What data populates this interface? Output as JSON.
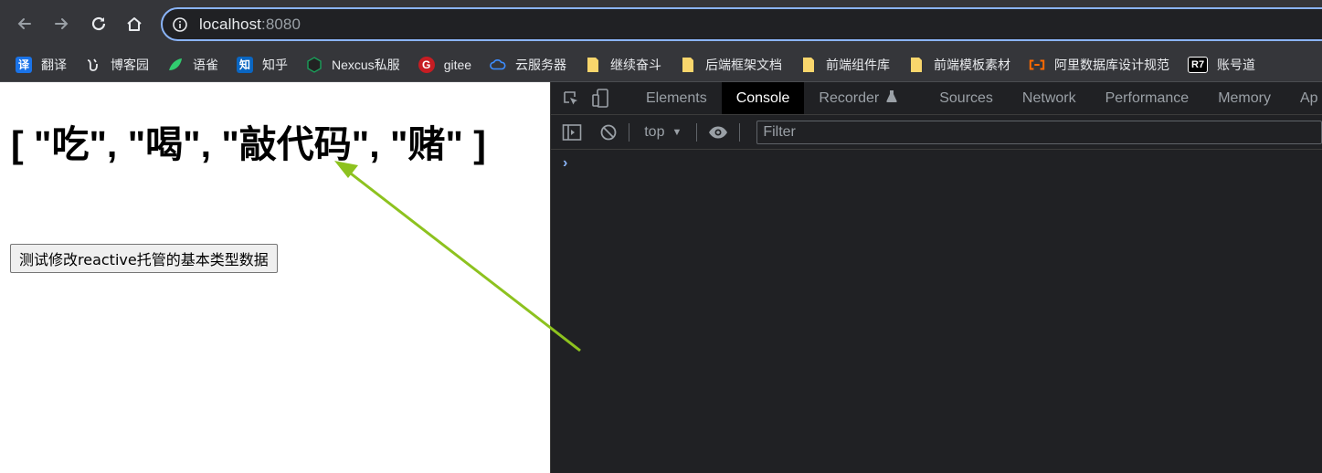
{
  "browser": {
    "url_host": "localhost",
    "url_port": ":8080"
  },
  "bookmarks": [
    {
      "label": "翻译",
      "icon": "translate-icon",
      "icon_text": "译",
      "color": "#1a73e8"
    },
    {
      "label": "博客园",
      "icon": "cnblogs-icon",
      "icon_text": "",
      "color": ""
    },
    {
      "label": "语雀",
      "icon": "yuque-icon",
      "icon_text": "",
      "color": "#31cc6f"
    },
    {
      "label": "知乎",
      "icon": "zhihu-icon",
      "icon_text": "知",
      "color": "#0a66c2"
    },
    {
      "label": "Nexcus私服",
      "icon": "nexus-icon",
      "icon_text": "",
      "color": "#1b9e5a"
    },
    {
      "label": "gitee",
      "icon": "gitee-icon",
      "icon_text": "G",
      "color": "#c71d23"
    },
    {
      "label": "云服务器",
      "icon": "cloud-icon",
      "icon_text": "",
      "color": "#3c8cff"
    },
    {
      "label": "继续奋斗",
      "icon": "folder-icon",
      "icon_text": "",
      "color": "#f9d66c"
    },
    {
      "label": "后端框架文档",
      "icon": "folder-icon",
      "icon_text": "",
      "color": "#f9d66c"
    },
    {
      "label": "前端组件库",
      "icon": "folder-icon",
      "icon_text": "",
      "color": "#f9d66c"
    },
    {
      "label": "前端模板素材",
      "icon": "folder-icon",
      "icon_text": "",
      "color": "#f9d66c"
    },
    {
      "label": "阿里数据库设计规范",
      "icon": "aliyun-icon",
      "icon_text": "",
      "color": "#ff6a00"
    },
    {
      "label": "账号道",
      "icon": "r7-icon",
      "icon_text": "R7",
      "color": "#000000"
    }
  ],
  "page": {
    "heading": "[ \"吃\", \"喝\", \"敲代码\", \"赌\" ]",
    "button_label": "测试修改reactive托管的基本类型数据"
  },
  "devtools": {
    "tabs": [
      {
        "label": "Elements",
        "active": false
      },
      {
        "label": "Console",
        "active": true
      },
      {
        "label": "Recorder",
        "active": false
      },
      {
        "label": "Sources",
        "active": false
      },
      {
        "label": "Network",
        "active": false
      },
      {
        "label": "Performance",
        "active": false
      },
      {
        "label": "Memory",
        "active": false
      },
      {
        "label": "Ap",
        "active": false
      }
    ],
    "context": "top",
    "filter_placeholder": "Filter",
    "prompt": "›"
  },
  "colors": {
    "arrow": "#8dc21f",
    "devtools_bg": "#202124",
    "toolbar_bg": "#35363a",
    "omnibox_border": "#8ab4f8"
  }
}
